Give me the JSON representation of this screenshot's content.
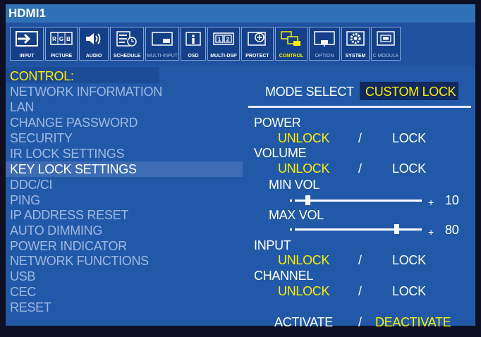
{
  "title": "HDMI1",
  "iconbar": [
    {
      "label": "INPUT",
      "icon": "input-icon",
      "state": "normal"
    },
    {
      "label": "PICTURE",
      "icon": "picture-rgb-icon",
      "state": "normal"
    },
    {
      "label": "AUDIO",
      "icon": "speaker-icon",
      "state": "normal"
    },
    {
      "label": "SCHEDULE",
      "icon": "schedule-icon",
      "state": "normal"
    },
    {
      "label": "MULTI-INPUT",
      "icon": "multi-input-icon",
      "state": "dim"
    },
    {
      "label": "OSD",
      "icon": "info-icon",
      "state": "normal"
    },
    {
      "label": "MULTI-DSP",
      "icon": "multi-display-icon",
      "state": "normal"
    },
    {
      "label": "PROTECT",
      "icon": "protect-icon",
      "state": "normal"
    },
    {
      "label": "CONTROL",
      "icon": "control-icon",
      "state": "selected"
    },
    {
      "label": "OPTION",
      "icon": "option-icon",
      "state": "dim"
    },
    {
      "label": "SYSTEM",
      "icon": "system-gear-icon",
      "state": "normal"
    },
    {
      "label": "C MODULE",
      "icon": "compute-module-icon",
      "state": "dim"
    }
  ],
  "picture_rgb_letters": [
    "R",
    "G",
    "B"
  ],
  "multidsp_digits": [
    "1",
    "2"
  ],
  "menu": {
    "header": "CONTROL:",
    "items": [
      "NETWORK INFORMATION",
      "LAN",
      "CHANGE PASSWORD",
      "SECURITY",
      "IR LOCK SETTINGS",
      "KEY LOCK SETTINGS",
      "DDC/CI",
      "PING",
      "IP ADDRESS RESET",
      "AUTO DIMMING",
      "POWER INDICATOR",
      "NETWORK FUNCTIONS",
      "USB",
      "CEC",
      "RESET"
    ],
    "active_item": "KEY LOCK SETTINGS"
  },
  "settings": {
    "mode_select_label": "MODE SELECT",
    "mode_select_value": "CUSTOM LOCK",
    "power_label": "POWER",
    "volume_label": "VOLUME",
    "input_label": "INPUT",
    "channel_label": "CHANNEL",
    "unlock": "UNLOCK",
    "lock": "LOCK",
    "slash": "/",
    "min_vol_label": "MIN VOL",
    "min_vol_value": "10",
    "min_vol_fraction": 0.1,
    "max_vol_label": "MAX VOL",
    "max_vol_value": "80",
    "max_vol_fraction": 0.8,
    "plus": "+",
    "activate": "ACTIVATE",
    "deactivate": "DEACTIVATE",
    "selected_lock_state": "UNLOCK",
    "selected_activation": "DEACTIVATE"
  },
  "colors": {
    "highlight": "#ffee00",
    "panel": "#2159a8",
    "title_bar": "#2f71b6",
    "inactive_text": "#9fb8e0"
  }
}
